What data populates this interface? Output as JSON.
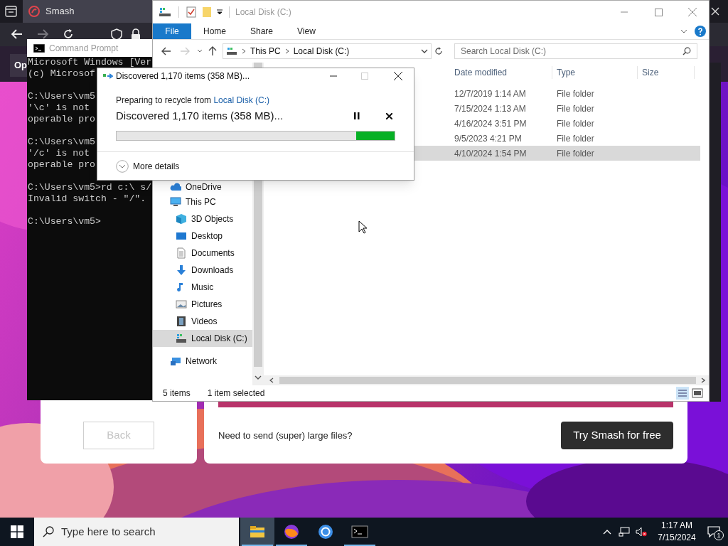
{
  "browser": {
    "tab_title": "Smash",
    "side_button": "Op",
    "back_button": "Back",
    "promo_text": "Need to send (super) large files?",
    "cta_button": "Try Smash for free"
  },
  "command_prompt": {
    "title": "Command Prompt",
    "blocks": [
      [
        "Microsoft Windows [Ver",
        "(c) Microsof"
      ],
      [
        "C:\\Users\\vm5",
        "'\\c' is not",
        "operable pro"
      ],
      [
        "C:\\Users\\vm5",
        "'/c' is not",
        "operable pro"
      ],
      [
        "C:\\Users\\vm5>rd c:\\ s/",
        "Invalid switch - \"/\"."
      ],
      [
        "C:\\Users\\vm5>"
      ]
    ]
  },
  "explorer": {
    "title": "Local Disk (C:)",
    "ribbon_tabs": [
      {
        "label": "File",
        "selected": true
      },
      {
        "label": "Home",
        "selected": false
      },
      {
        "label": "Share",
        "selected": false
      },
      {
        "label": "View",
        "selected": false
      }
    ],
    "breadcrumb": [
      "This PC",
      "Local Disk (C:)"
    ],
    "search": {
      "placeholder": "Search Local Disk (C:)"
    },
    "nav": [
      {
        "label": "OneDrive",
        "kind": "cloud",
        "selected": false
      },
      {
        "label": "This PC",
        "kind": "pc",
        "selected": false,
        "children": [
          {
            "label": "3D Objects",
            "kind": "cube",
            "selected": false
          },
          {
            "label": "Desktop",
            "kind": "desktop",
            "selected": false
          },
          {
            "label": "Documents",
            "kind": "document",
            "selected": false
          },
          {
            "label": "Downloads",
            "kind": "download",
            "selected": false
          },
          {
            "label": "Music",
            "kind": "music",
            "selected": false
          },
          {
            "label": "Pictures",
            "kind": "pictures",
            "selected": false
          },
          {
            "label": "Videos",
            "kind": "videos",
            "selected": false
          },
          {
            "label": "Local Disk (C:)",
            "kind": "drive",
            "selected": true
          }
        ]
      },
      {
        "label": "Network",
        "kind": "network",
        "selected": false
      }
    ],
    "columns": [
      "Date modified",
      "Type",
      "Size"
    ],
    "rows": [
      {
        "date_modified": "12/7/2019 1:14 AM",
        "type": "File folder",
        "selected": false
      },
      {
        "date_modified": "7/15/2024 1:13 AM",
        "type": "File folder",
        "selected": false
      },
      {
        "date_modified": "4/16/2024 3:51 PM",
        "type": "File folder",
        "selected": false
      },
      {
        "date_modified": "9/5/2023 4:21 PM",
        "type": "File folder",
        "selected": false
      },
      {
        "date_modified": "4/10/2024 1:54 PM",
        "type": "File folder",
        "selected": true
      }
    ],
    "status": {
      "count": "5 items",
      "selection": "1 item selected"
    }
  },
  "dialog": {
    "title": "Discovered 1,170 items (358 MB)...",
    "from_prefix": "Preparing to recycle from",
    "from_link": "Local Disk (C:)",
    "heading": "Discovered 1,170 items (358 MB)...",
    "more_details": "More details"
  },
  "taskbar": {
    "search": {
      "placeholder": "Type here to search"
    },
    "apps": [
      {
        "kind": "folder",
        "active": true,
        "running": true
      },
      {
        "kind": "fox",
        "active": false,
        "running": true
      },
      {
        "kind": "ring",
        "active": false,
        "running": false
      },
      {
        "kind": "terminal",
        "active": false,
        "running": true
      }
    ],
    "time": "1:17 AM",
    "date": "7/15/2024",
    "notifications": "1"
  }
}
